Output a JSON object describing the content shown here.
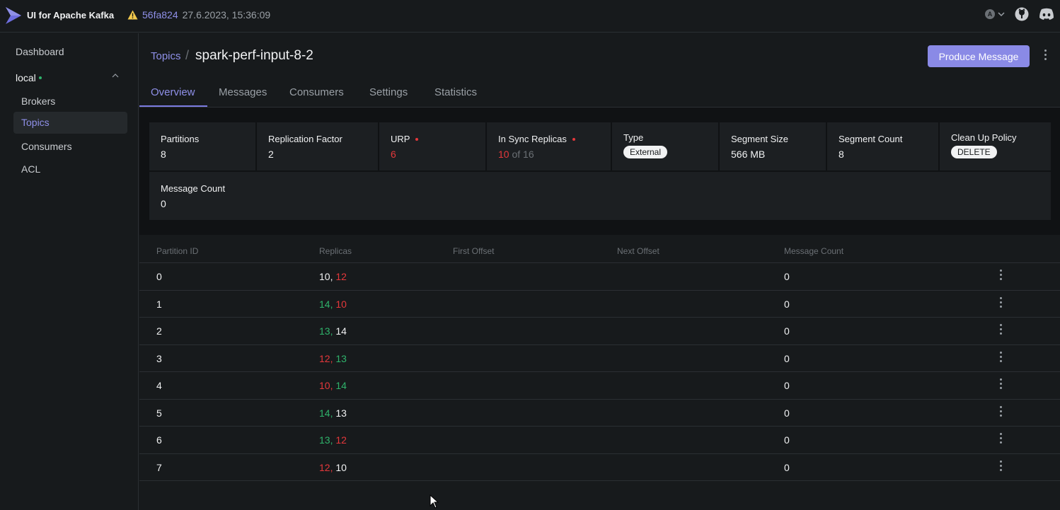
{
  "topnav": {
    "brand": "UI for Apache Kafka",
    "version_hash": "56fa824",
    "version_date": "27.6.2023, 15:36:09",
    "theme_letter": "A",
    "icons": [
      "logo-icon",
      "warning-icon",
      "chevron-down-icon",
      "github-icon",
      "discord-icon"
    ]
  },
  "sidebar": {
    "dashboard": "Dashboard",
    "cluster": "local",
    "items": [
      {
        "label": "Brokers",
        "active": false
      },
      {
        "label": "Topics",
        "active": true
      },
      {
        "label": "Consumers",
        "active": false
      },
      {
        "label": "ACL",
        "active": false
      }
    ]
  },
  "header": {
    "breadcrumb": "Topics",
    "separator": "/",
    "title": "spark-perf-input-8-2",
    "produce_button": "Produce Message"
  },
  "tabs": [
    "Overview",
    "Messages",
    "Consumers",
    "Settings",
    "Statistics"
  ],
  "active_tab": "Overview",
  "metrics": {
    "partitions": {
      "label": "Partitions",
      "value": "8"
    },
    "replication_factor": {
      "label": "Replication Factor",
      "value": "2"
    },
    "urp": {
      "label": "URP",
      "value": "6"
    },
    "in_sync_replicas": {
      "label": "In Sync Replicas",
      "value": "10",
      "of_text": "of 16"
    },
    "type": {
      "label": "Type",
      "value": "External"
    },
    "segment_size": {
      "label": "Segment Size",
      "value": "566 MB"
    },
    "segment_count": {
      "label": "Segment Count",
      "value": "8"
    },
    "clean_up_policy": {
      "label": "Clean Up Policy",
      "value": "DELETE"
    },
    "message_count": {
      "label": "Message Count",
      "value": "0"
    }
  },
  "table": {
    "headers": [
      "Partition ID",
      "Replicas",
      "First Offset",
      "Next Offset",
      "Message Count"
    ],
    "rows": [
      {
        "id": "0",
        "r1": "10,",
        "r1_color": "white",
        "r2": "12",
        "r2_color": "red",
        "count": "0"
      },
      {
        "id": "1",
        "r1": "14,",
        "r1_color": "green",
        "r2": "10",
        "r2_color": "red",
        "count": "0"
      },
      {
        "id": "2",
        "r1": "13,",
        "r1_color": "green",
        "r2": "14",
        "r2_color": "white",
        "count": "0"
      },
      {
        "id": "3",
        "r1": "12,",
        "r1_color": "red",
        "r2": "13",
        "r2_color": "green",
        "count": "0"
      },
      {
        "id": "4",
        "r1": "10,",
        "r1_color": "red",
        "r2": "14",
        "r2_color": "green",
        "count": "0"
      },
      {
        "id": "5",
        "r1": "14,",
        "r1_color": "green",
        "r2": "13",
        "r2_color": "white",
        "count": "0"
      },
      {
        "id": "6",
        "r1": "13,",
        "r1_color": "green",
        "r2": "12",
        "r2_color": "red",
        "count": "0"
      },
      {
        "id": "7",
        "r1": "12,",
        "r1_color": "red",
        "r2": "10",
        "r2_color": "white",
        "count": "0"
      }
    ]
  },
  "colors": {
    "accent": "#8f90e8",
    "red": "#e5383b",
    "green": "#2fb36b",
    "white": "#f1f2f3"
  }
}
